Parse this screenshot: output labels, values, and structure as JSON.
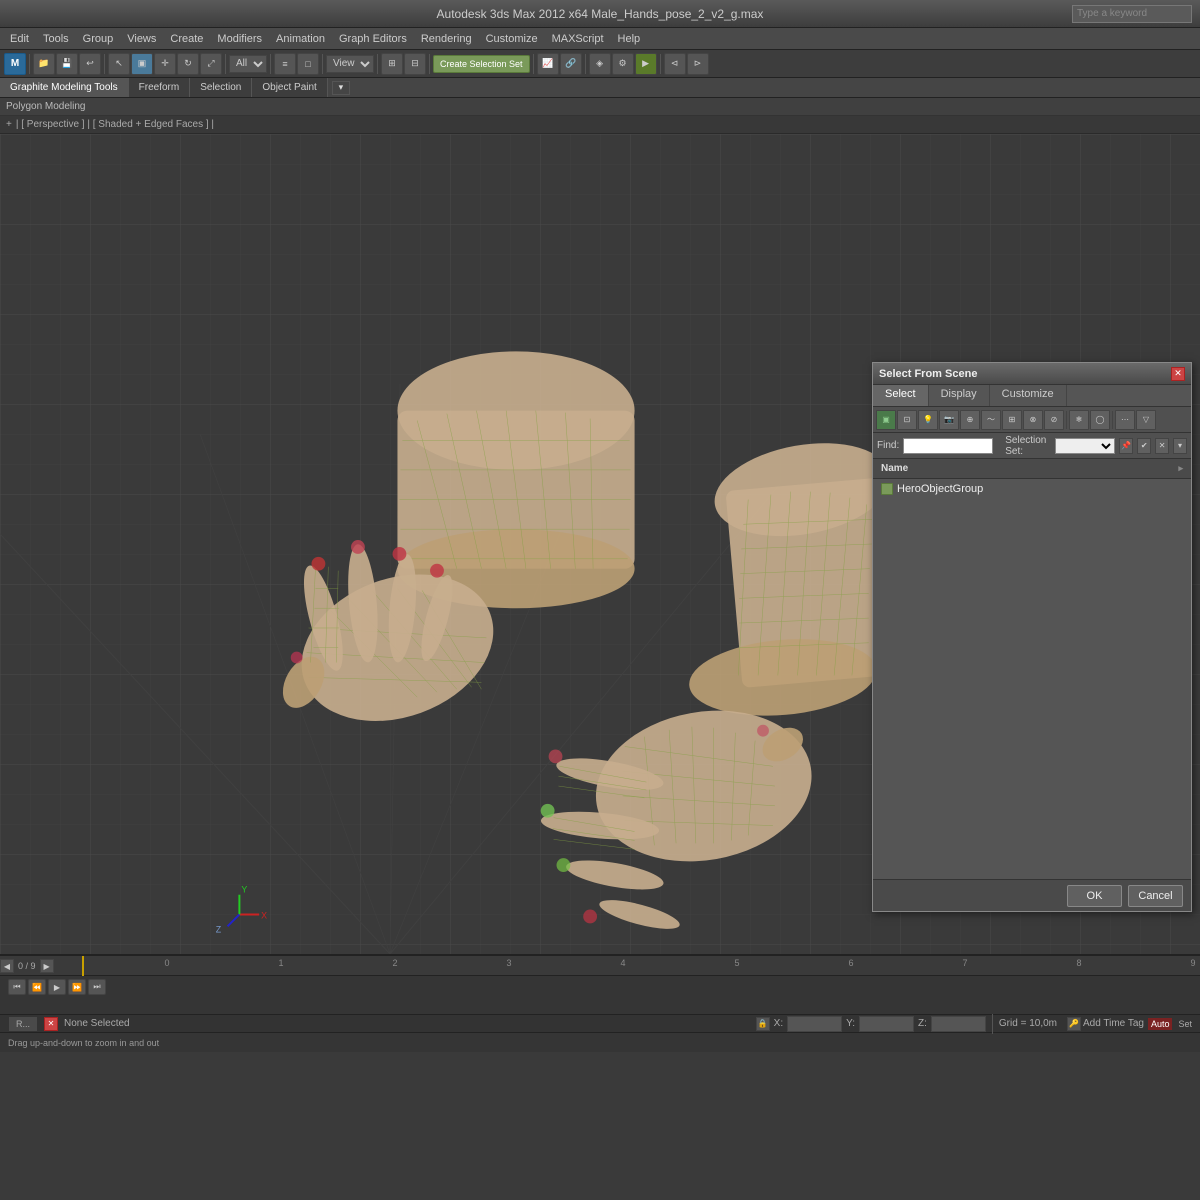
{
  "titleBar": {
    "title": "Autodesk 3ds Max 2012 x64   Male_Hands_pose_2_v2_g.max",
    "keywordPlaceholder": "Type a keyword"
  },
  "menuBar": {
    "items": [
      {
        "label": "Edit",
        "id": "edit"
      },
      {
        "label": "Tools",
        "id": "tools"
      },
      {
        "label": "Group",
        "id": "group"
      },
      {
        "label": "Views",
        "id": "views"
      },
      {
        "label": "Create",
        "id": "create"
      },
      {
        "label": "Modifiers",
        "id": "modifiers"
      },
      {
        "label": "Animation",
        "id": "animation"
      },
      {
        "label": "Graph Editors",
        "id": "graph-editors"
      },
      {
        "label": "Rendering",
        "id": "rendering"
      },
      {
        "label": "Customize",
        "id": "customize"
      },
      {
        "label": "MAXScript",
        "id": "maxscript"
      },
      {
        "label": "Help",
        "id": "help"
      }
    ]
  },
  "tabs": [
    {
      "label": "Graphite Modeling Tools",
      "active": true
    },
    {
      "label": "Freeform",
      "active": false
    },
    {
      "label": "Selection",
      "active": false
    },
    {
      "label": "Object Paint",
      "active": false
    }
  ],
  "polyBar": {
    "label": "Polygon Modeling"
  },
  "viewportInfo": {
    "items": [
      {
        "label": "+ "
      },
      {
        "label": "[ Perspective ]"
      },
      {
        "label": "[ Shaded + Edged Faces ]"
      }
    ]
  },
  "toolbar": {
    "createSelBtn": "Create Selection Set",
    "viewDropdown": "View"
  },
  "selectFromScene": {
    "title": "Select From Scene",
    "tabs": [
      "Select",
      "Display",
      "Customize"
    ],
    "findLabel": "Find:",
    "findValue": "",
    "selectionSetLabel": "Selection Set:",
    "selectionSetValue": "",
    "listHeader": "Name",
    "listItems": [
      {
        "icon": "cube",
        "name": "HeroObjectGroup"
      }
    ],
    "okLabel": "OK",
    "cancelLabel": "Cancel"
  },
  "statusBar": {
    "text": "None Selected"
  },
  "bottomStatus": {
    "xLabel": "X:",
    "xValue": "",
    "yLabel": "Y:",
    "yValue": "",
    "zLabel": "Z:",
    "zValue": "",
    "gridLabel": "Grid = 10,0m",
    "addTimeTag": "Add Time Tag",
    "timeValue": "0 / 9"
  },
  "hint": {
    "text": "Drag up-and-down to zoom in and out"
  },
  "timeline": {
    "numbers": [
      "0",
      "1",
      "2",
      "3",
      "4",
      "5",
      "6",
      "7",
      "8",
      "9"
    ]
  }
}
